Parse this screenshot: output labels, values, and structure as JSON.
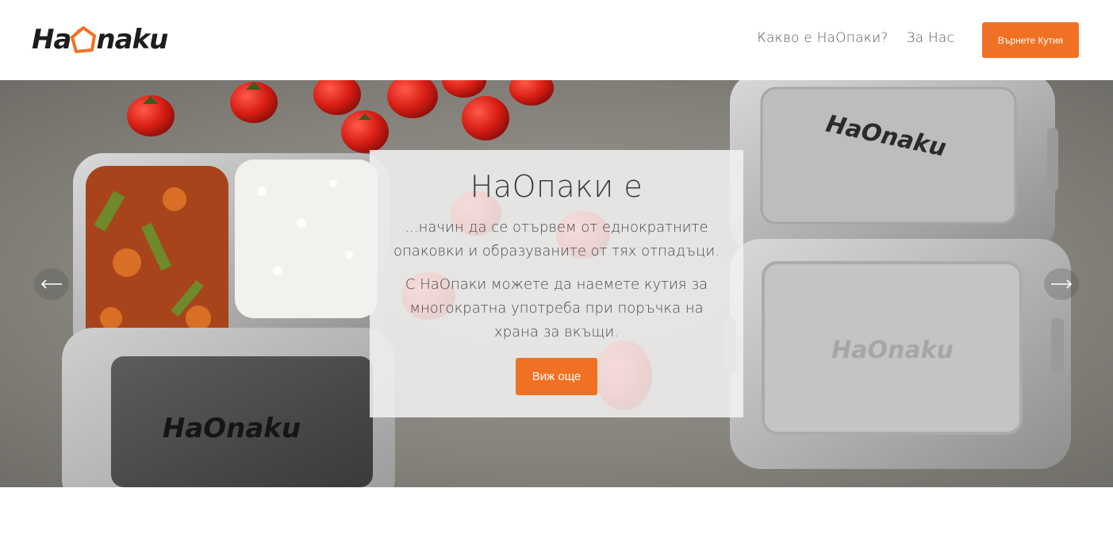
{
  "brand": {
    "logo_text_left": "Ha",
    "logo_text_right": "naku",
    "accent_color": "#f07123",
    "logo_icon": "box-icon"
  },
  "nav": {
    "items": [
      {
        "label": "Какво е НаОпаки?"
      },
      {
        "label": "За Нас"
      }
    ],
    "cta_label": "Върнете Кутия"
  },
  "hero": {
    "title": "НаОпаки е",
    "text1": "...начин да се отървем от еднократните опаковки и образуваните от тях отпадъци.",
    "text2": "С НаОпаки можете да наемете кутия за многократна употреба при поръчка на храна за вкъщи.",
    "button_label": "Виж още",
    "prev_icon": "arrow-left-icon",
    "next_icon": "arrow-right-icon",
    "box_logo_text": "HaOnaku"
  }
}
